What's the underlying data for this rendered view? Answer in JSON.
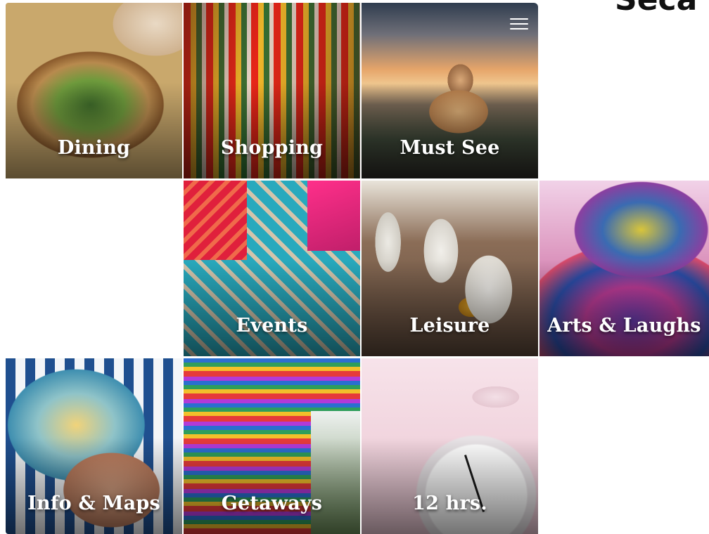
{
  "header": {
    "corner_text": "Seca"
  },
  "menu": {
    "icon": "hamburger-menu-icon"
  },
  "tiles": [
    {
      "id": "dining",
      "label": "Dining"
    },
    {
      "id": "shopping",
      "label": "Shopping"
    },
    {
      "id": "must-see",
      "label": "Must See"
    },
    {
      "id": "events",
      "label": "Events"
    },
    {
      "id": "leisure",
      "label": "Leisure"
    },
    {
      "id": "arts-laughs",
      "label": "Arts & Laughs"
    },
    {
      "id": "info-maps",
      "label": "Info & Maps"
    },
    {
      "id": "getaways",
      "label": "Getaways"
    },
    {
      "id": "12-hrs",
      "label": "12 hrs."
    }
  ]
}
